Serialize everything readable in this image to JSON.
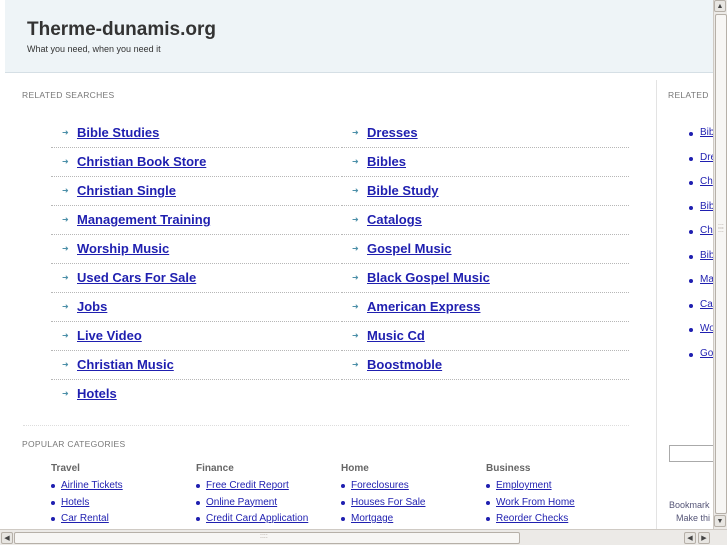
{
  "header": {
    "title": "Therme-dunamis.org",
    "tagline": "What you need, when you need it"
  },
  "related_searches": {
    "label": "RELATED SEARCHES",
    "left": [
      "Bible Studies",
      "Christian Book Store",
      "Christian Single",
      "Management Training",
      "Worship Music",
      "Used Cars For Sale",
      "Jobs",
      "Live Video",
      "Christian Music",
      "Hotels"
    ],
    "right": [
      "Dresses",
      "Bibles",
      "Bible Study",
      "Catalogs",
      "Gospel Music",
      "Black Gospel Music",
      "American Express",
      "Music Cd",
      "Boostmoble"
    ]
  },
  "popular_categories": {
    "label": "POPULAR CATEGORIES",
    "columns": [
      {
        "title": "Travel",
        "items": [
          "Airline Tickets",
          "Hotels",
          "Car Rental"
        ]
      },
      {
        "title": "Finance",
        "items": [
          "Free Credit Report",
          "Online Payment",
          "Credit Card Application"
        ]
      },
      {
        "title": "Home",
        "items": [
          "Foreclosures",
          "Houses For Sale",
          "Mortgage"
        ]
      },
      {
        "title": "Business",
        "items": [
          "Employment",
          "Work From Home",
          "Reorder Checks"
        ]
      }
    ]
  },
  "right_panel": {
    "label": "RELATED",
    "items": [
      "Bib",
      "Dre",
      "Ch",
      "Bib",
      "Ch",
      "Bib",
      "Ma",
      "Ca",
      "Wo",
      "Go"
    ],
    "bookmark_text": "Bookmark",
    "make_this_text": "Make thi"
  },
  "scrollbars": {
    "up_arrow": "▲",
    "down_arrow": "▼",
    "left_arrow": "◀",
    "right_arrow": "▶"
  },
  "link_arrow": "➜"
}
